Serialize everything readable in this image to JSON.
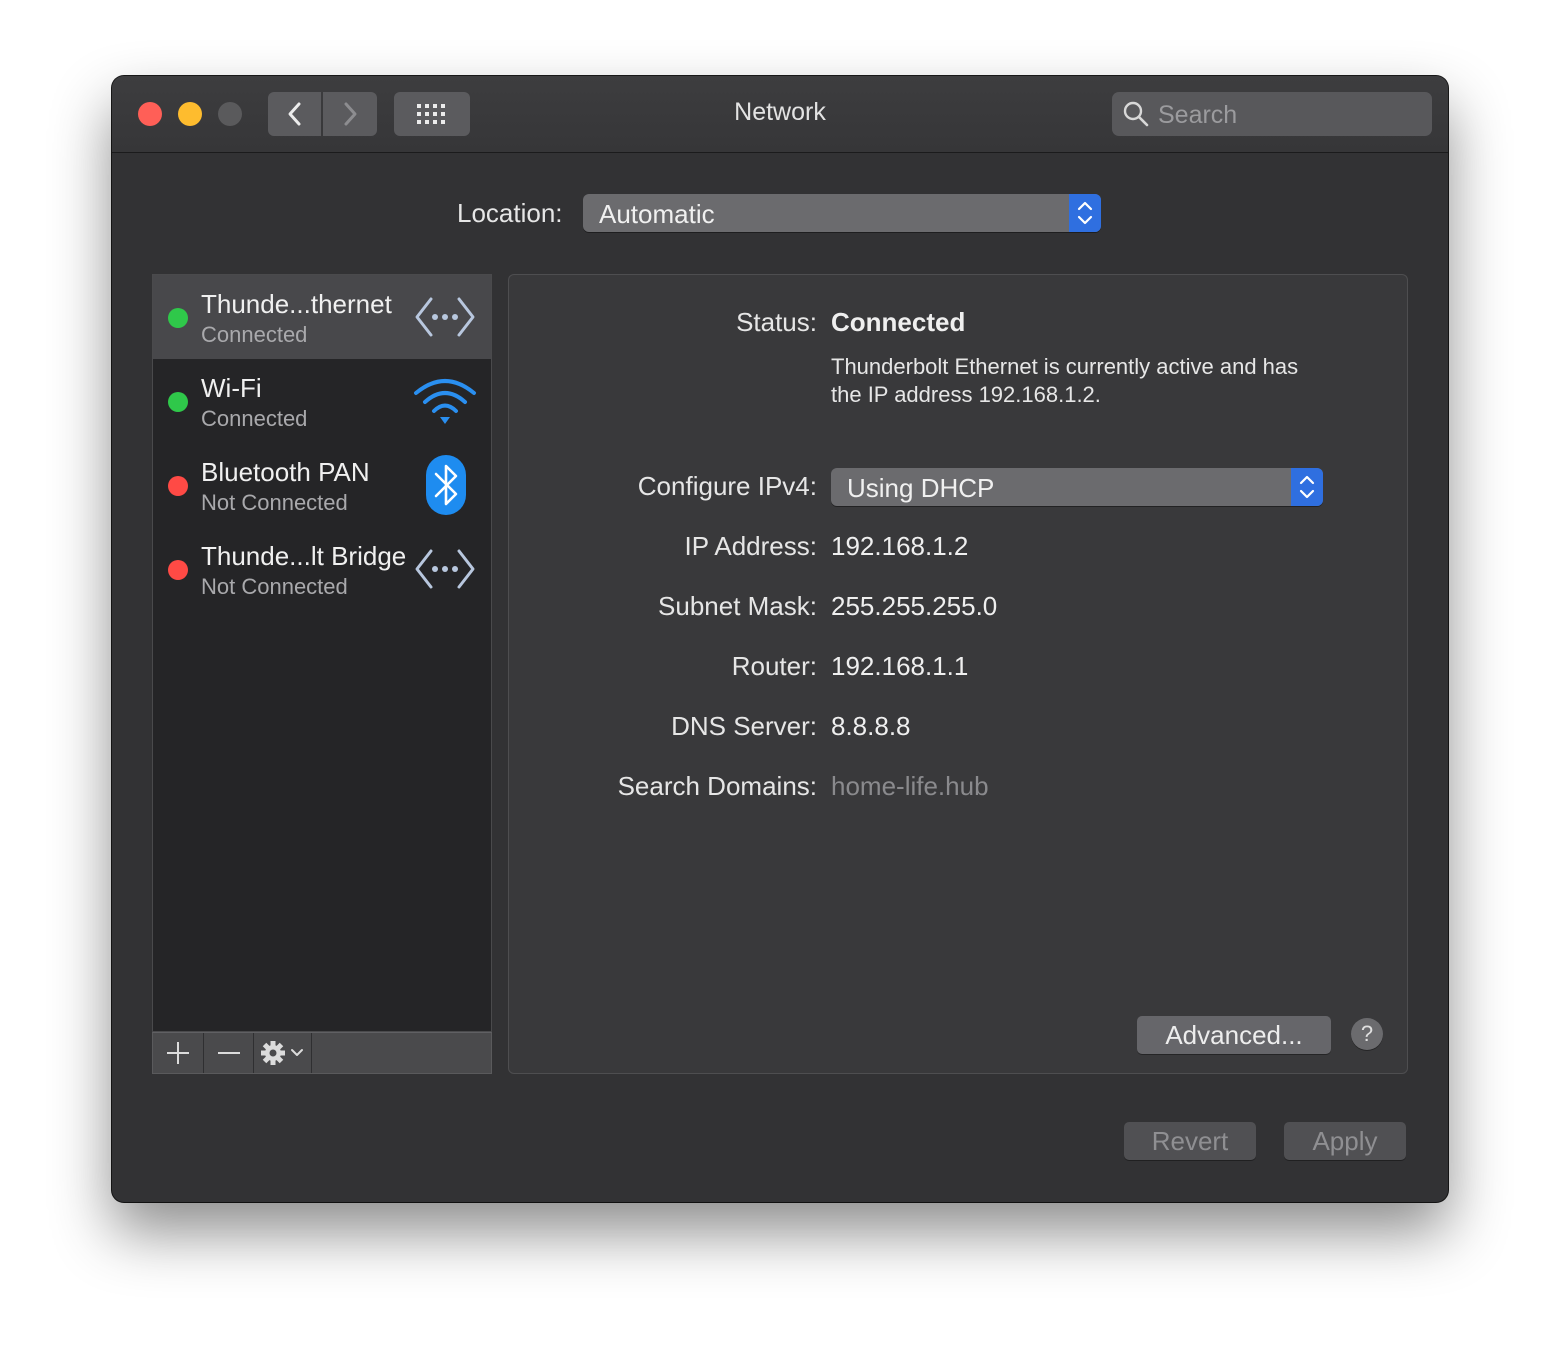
{
  "window": {
    "title": "Network",
    "search_placeholder": "Search"
  },
  "location": {
    "label": "Location:",
    "value": "Automatic"
  },
  "services": [
    {
      "name": "Thunde...thernet",
      "state": "Connected",
      "status_color": "#2fc84a",
      "icon": "ethernet-icon",
      "selected": true
    },
    {
      "name": "Wi-Fi",
      "state": "Connected",
      "status_color": "#2fc84a",
      "icon": "wifi-icon",
      "selected": false
    },
    {
      "name": "Bluetooth PAN",
      "state": "Not Connected",
      "status_color": "#ff4a45",
      "icon": "bluetooth-icon",
      "selected": false
    },
    {
      "name": "Thunde...lt Bridge",
      "state": "Not Connected",
      "status_color": "#ff4a45",
      "icon": "ethernet-icon",
      "selected": false
    }
  ],
  "sidebar_controls": {
    "add": "+",
    "remove": "−"
  },
  "details": {
    "status_label": "Status:",
    "status_value": "Connected",
    "status_description": "Thunderbolt Ethernet is currently active and has the IP address 192.168.1.2.",
    "configure_label": "Configure IPv4:",
    "configure_value": "Using DHCP",
    "ip_label": "IP Address:",
    "ip_value": "192.168.1.2",
    "subnet_label": "Subnet Mask:",
    "subnet_value": "255.255.255.0",
    "router_label": "Router:",
    "router_value": "192.168.1.1",
    "dns_label": "DNS Server:",
    "dns_value": "8.8.8.8",
    "domains_label": "Search Domains:",
    "domains_value": "home-life.hub",
    "advanced_label": "Advanced...",
    "help_label": "?"
  },
  "footer": {
    "revert_label": "Revert",
    "apply_label": "Apply"
  },
  "colors": {
    "accent": "#2f6fe0",
    "connected": "#2fc84a",
    "disconnected": "#ff4a45",
    "bluetooth": "#1e8cf0"
  }
}
